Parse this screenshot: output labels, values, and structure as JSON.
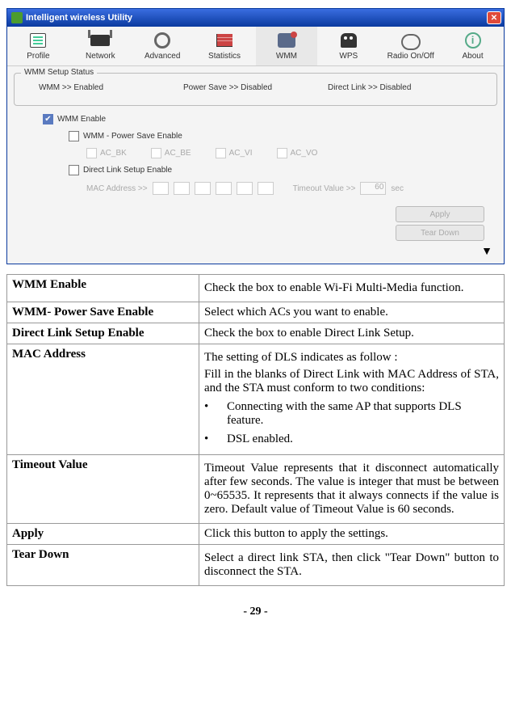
{
  "window": {
    "title": "Intelligent wireless Utility"
  },
  "tabs": {
    "profile": "Profile",
    "network": "Network",
    "advanced": "Advanced",
    "statistics": "Statistics",
    "wmm": "WMM",
    "wps": "WPS",
    "radio": "Radio On/Off",
    "about": "About"
  },
  "groupbox": {
    "title": "WMM Setup Status",
    "status": {
      "wmm": "WMM >> Enabled",
      "powersave": "Power Save >> Disabled",
      "directlink": "Direct Link >> Disabled"
    },
    "checks": {
      "wmm_enable": "WMM Enable",
      "power_save": "WMM - Power Save Enable",
      "direct_link": "Direct Link Setup Enable"
    },
    "acs": {
      "bk": "AC_BK",
      "be": "AC_BE",
      "vi": "AC_VI",
      "vo": "AC_VO"
    },
    "mac_label": "MAC Address >>",
    "timeout_label": "Timeout Value >>",
    "timeout_value": "60",
    "timeout_unit": "sec"
  },
  "buttons": {
    "apply": "Apply",
    "teardown": "Tear Down"
  },
  "table": {
    "r0": {
      "label": "WMM Enable",
      "desc": "Check the box to enable Wi-Fi Multi-Media function."
    },
    "r1": {
      "label": "WMM- Power Save Enable",
      "desc": "Select which ACs you want to enable."
    },
    "r2": {
      "label": "Direct Link Setup Enable",
      "desc": "Check the box to enable Direct Link Setup."
    },
    "r3": {
      "label": "MAC Address",
      "p1": "The setting of DLS indicates as follow :",
      "p2": "Fill in the blanks of Direct Link with MAC Address of STA, and the STA must conform to two conditions:",
      "li1": "Connecting with the same AP that supports DLS feature.",
      "li2": "DSL enabled."
    },
    "r4": {
      "label": "Timeout Value",
      "desc": "Timeout Value represents that it disconnect automatically after few seconds. The value is integer that must be between 0~65535. It represents that it always connects if the value is zero. Default value of Timeout Value is 60 seconds."
    },
    "r5": {
      "label": "Apply",
      "desc": "Click this button to apply the settings."
    },
    "r6": {
      "label": "Tear Down",
      "desc": "Select a direct link STA, then click \"Tear Down\" button to disconnect the STA."
    }
  },
  "pagenum": "- 29 -"
}
